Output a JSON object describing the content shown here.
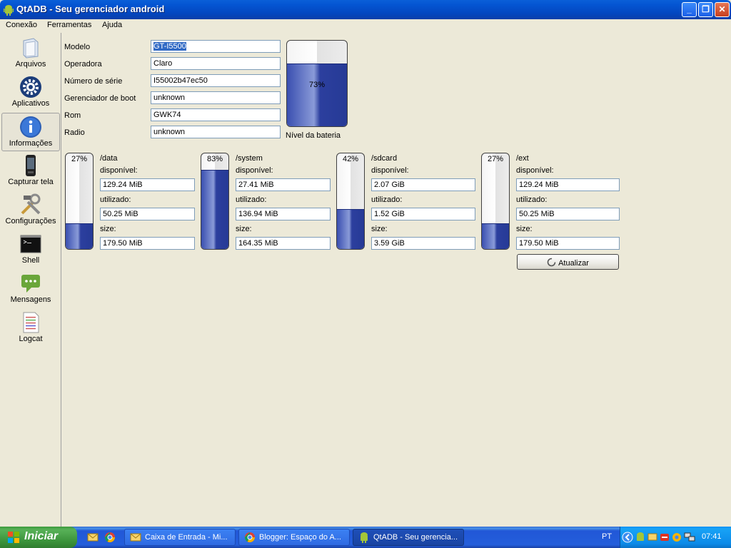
{
  "window": {
    "title": "QtADB - Seu gerenciador android"
  },
  "menu": {
    "items": [
      "Conexão",
      "Ferramentas",
      "Ajuda"
    ]
  },
  "sidebar": {
    "items": [
      {
        "label": "Arquivos",
        "icon": "folder-icon"
      },
      {
        "label": "Aplicativos",
        "icon": "gear-icon"
      },
      {
        "label": "Informações",
        "icon": "info-icon",
        "active": true
      },
      {
        "label": "Capturar tela",
        "icon": "phone-icon"
      },
      {
        "label": "Configurações",
        "icon": "tools-icon"
      },
      {
        "label": "Shell",
        "icon": "terminal-icon"
      },
      {
        "label": "Mensagens",
        "icon": "message-icon"
      },
      {
        "label": "Logcat",
        "icon": "log-icon"
      }
    ]
  },
  "device_info": {
    "fields": [
      {
        "label": "Modelo",
        "value": "GT-I5500"
      },
      {
        "label": "Operadora",
        "value": "Claro"
      },
      {
        "label": "Número de série",
        "value": "I55002b47ec50"
      },
      {
        "label": "Gerenciador de boot",
        "value": "unknown"
      },
      {
        "label": "Rom",
        "value": "GWK74"
      },
      {
        "label": "Radio",
        "value": "unknown"
      }
    ]
  },
  "battery": {
    "label": "Nível da bateria",
    "percent_text": "73%",
    "level": 0.73
  },
  "storage": {
    "labels": {
      "available": "disponível:",
      "used": "utilizado:",
      "size": "size:"
    },
    "partitions": [
      {
        "name": "/data",
        "percent_text": "27%",
        "level": 0.27,
        "available": "129.24 MiB",
        "used": "50.25 MiB",
        "size": "179.50 MiB"
      },
      {
        "name": "/system",
        "percent_text": "83%",
        "level": 0.83,
        "available": "27.41 MiB",
        "used": "136.94 MiB",
        "size": "164.35 MiB"
      },
      {
        "name": "/sdcard",
        "percent_text": "42%",
        "level": 0.42,
        "available": "2.07 GiB",
        "used": "1.52 GiB",
        "size": "3.59 GiB"
      },
      {
        "name": "/ext",
        "percent_text": "27%",
        "level": 0.27,
        "available": "129.24 MiB",
        "used": "50.25 MiB",
        "size": "179.50 MiB"
      }
    ],
    "refresh_label": "Atualizar"
  },
  "taskbar": {
    "start_label": "Iniciar",
    "tasks": [
      {
        "label": "Caixa de Entrada - Mi...",
        "icon": "mail-icon"
      },
      {
        "label": "Blogger: Espaço do A...",
        "icon": "chrome-icon"
      },
      {
        "label": "QtADB - Seu gerencia...",
        "icon": "android-icon",
        "active": true
      }
    ],
    "language": "PT",
    "clock": "07:41"
  },
  "colors": {
    "accent": "#0a5fd8",
    "fill": "#3a4fb0",
    "taskbar": "#245edb",
    "start": "#3a923a"
  }
}
